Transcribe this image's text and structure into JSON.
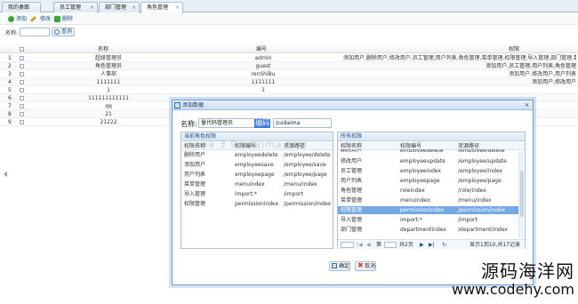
{
  "tabs": [
    {
      "label": "我的桌面"
    },
    {
      "label": "员工管理"
    },
    {
      "label": "部门管理"
    },
    {
      "label": "角色管理",
      "active": true
    }
  ],
  "tab_close_glyph": "×",
  "toolbar": {
    "add": "添加",
    "edit": "修改",
    "delete": "删除"
  },
  "search": {
    "label": "名称:",
    "value": "",
    "button": "查询"
  },
  "grid": {
    "headers": {
      "name": "名称",
      "code": "编号",
      "permissions": "权限"
    },
    "rows": [
      {
        "no": "1",
        "name": "超级管理员",
        "code": "admin",
        "permissions": "添加用户,删除用户,修改用户,员工管理,用户列表,角色管理,菜单管理,权限管理,导入管理,部门管理,数据字典管理"
      },
      {
        "no": "2",
        "name": "角色管理员",
        "code": "guest",
        "permissions": "添加用户,员工管理,用户列表,角色管理"
      },
      {
        "no": "3",
        "name": "人事部",
        "code": "renShiBu",
        "permissions": "添加用户,修改用户,用户列表"
      },
      {
        "no": "4",
        "name": "1111111",
        "code": "1111111",
        "permissions": "添加用户,修改用户"
      },
      {
        "no": "5",
        "name": "1",
        "code": "1",
        "permissions": ""
      },
      {
        "no": "6",
        "name": "111111111111",
        "code": "",
        "permissions": ""
      },
      {
        "no": "7",
        "name": "qq",
        "code": "",
        "permissions": ""
      },
      {
        "no": "8",
        "name": "21",
        "code": "",
        "permissions": ""
      },
      {
        "no": "9",
        "name": "21222",
        "code": "",
        "permissions": ""
      }
    ]
  },
  "dialog": {
    "title": "添加数据",
    "close_glyph": "×",
    "name_label": "名称:",
    "name_value": "量代码管理员",
    "code_label": "编码",
    "code_value": "zuidaima",
    "current_panel": {
      "title": "当前角色权限",
      "headers": {
        "name": "权限名称",
        "code": "权限编号",
        "path": "资源路径"
      },
      "rows": [
        {
          "name": "删除用户",
          "code": "employeedelete",
          "path": "/employee/delete"
        },
        {
          "name": "添加用户",
          "code": "employeesave",
          "path": "/employee/save"
        },
        {
          "name": "用户列表",
          "code": "employeepage",
          "path": "/employee/page"
        },
        {
          "name": "菜单管理",
          "code": "menuindex",
          "path": "/menu/index"
        },
        {
          "name": "导入管理",
          "code": "import:*",
          "path": "/import"
        },
        {
          "name": "权限管理",
          "code": "permissionindex",
          "path": "/permission/index"
        }
      ]
    },
    "all_panel": {
      "title": "所有权限",
      "headers": {
        "name": "权限名称",
        "code": "权限编号",
        "path": "资源路径"
      },
      "rows": [
        {
          "name": "删除用户",
          "code": "employeedelete",
          "path": "/employee/delete",
          "partial": true
        },
        {
          "name": "修改用户",
          "code": "employeeupdate",
          "path": "/employee/update"
        },
        {
          "name": "员工管理",
          "code": "employeeindex",
          "path": "/employee/index"
        },
        {
          "name": "用户列表",
          "code": "employeepage",
          "path": "/employee/page"
        },
        {
          "name": "角色管理",
          "code": "roleindex",
          "path": "/role/index"
        },
        {
          "name": "菜单管理",
          "code": "menuindex",
          "path": "/menu/index"
        },
        {
          "name": "权限管理",
          "code": "permissionindex",
          "path": "/permission/index",
          "selected": true
        },
        {
          "name": "导入管理",
          "code": "import:*",
          "path": "/import"
        },
        {
          "name": "部门管理",
          "code": "departmentindex",
          "path": "/department/index"
        }
      ],
      "pager": {
        "page_size": "",
        "page_label": "第",
        "page_value": "",
        "total": "共2页",
        "info": "显示1到10,共17记录"
      }
    },
    "ok_button": "确定",
    "cancel_button": "取消"
  },
  "watermark_center": "sea 3 9 zaaima b m",
  "watermark_cn": "源码海洋网",
  "watermark_url": "www.codehy.com",
  "colors": {
    "accent": "#3a7bd5",
    "selected_row": "#76a9e2",
    "title_bar": "#cfdff2",
    "add_icon": "#3aa43a",
    "edit_icon": "#d6a21b",
    "delete_icon": "#3aa43a"
  }
}
